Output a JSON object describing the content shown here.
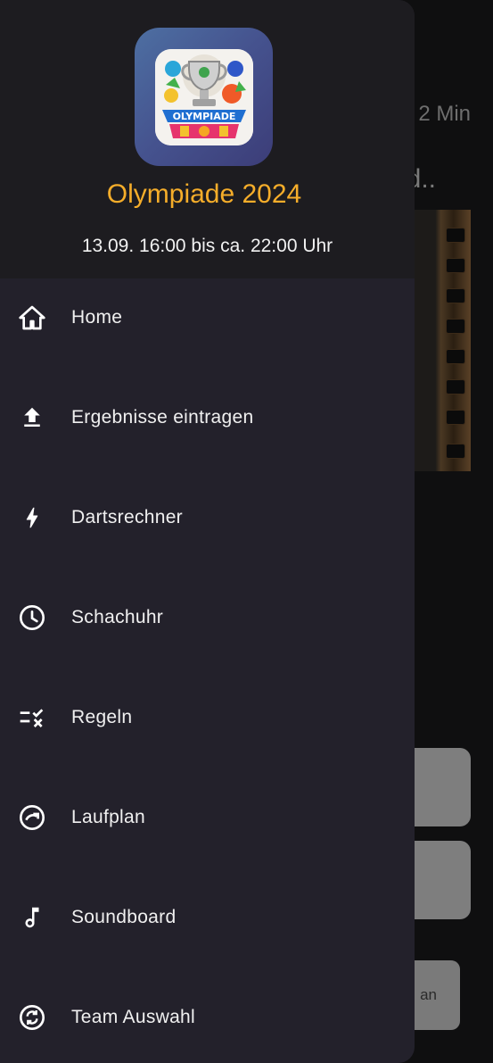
{
  "background": {
    "duration_text": "2 Min",
    "title_fragment": "d..",
    "button_fragment": "an"
  },
  "drawer": {
    "app_title": "Olympiade 2024",
    "event_time": "13.09. 16:00 bis ca. 22:00 Uhr",
    "logo_text": "OLYMPIADE",
    "items": [
      {
        "label": "Home",
        "icon": "home-icon"
      },
      {
        "label": "Ergebnisse eintragen",
        "icon": "upload-icon"
      },
      {
        "label": "Dartsrechner",
        "icon": "bolt-icon"
      },
      {
        "label": "Schachuhr",
        "icon": "clock-icon"
      },
      {
        "label": "Regeln",
        "icon": "rules-checklist-icon"
      },
      {
        "label": "Laufplan",
        "icon": "progress-arrow-icon"
      },
      {
        "label": "Soundboard",
        "icon": "music-note-icon"
      },
      {
        "label": "Team Auswahl",
        "icon": "sync-circle-icon"
      }
    ]
  },
  "colors": {
    "accent": "#f5ad2a",
    "drawer_bg": "#23212b",
    "header_bg": "#1d1c20"
  }
}
